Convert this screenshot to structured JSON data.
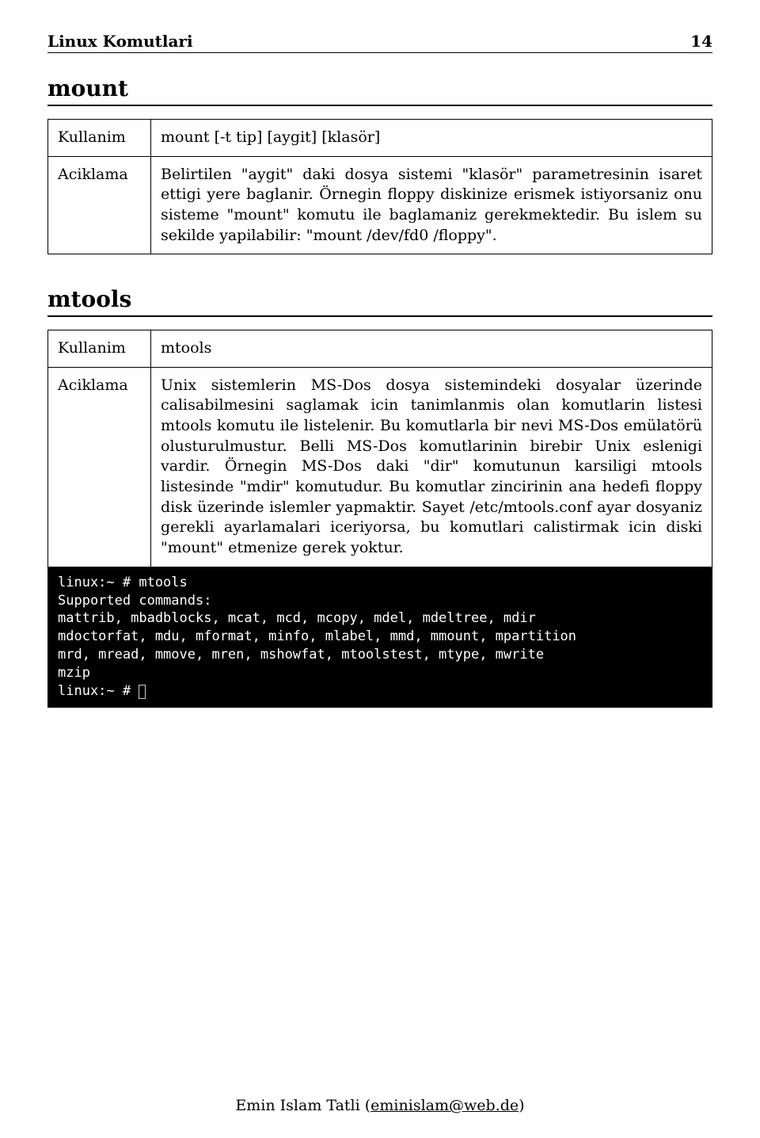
{
  "header": {
    "title": "Linux Komutlari",
    "page": "14"
  },
  "sections": {
    "mount": {
      "title": "mount",
      "kullanim_label": "Kullanim",
      "kullanim_value": "mount [-t tip] [aygit] [klasör]",
      "aciklama_label": "Aciklama",
      "aciklama_value": "Belirtilen \"aygit\" daki dosya sistemi \"klasör\" parametresinin isaret ettigi yere baglanir. Örnegin floppy diskinize erismek istiyorsaniz onu sisteme \"mount\" komutu ile baglamaniz gerekmektedir. Bu islem su sekilde yapilabilir: \"mount /dev/fd0 /floppy\"."
    },
    "mtools": {
      "title": "mtools",
      "kullanim_label": "Kullanim",
      "kullanim_value": "mtools",
      "aciklama_label": "Aciklama",
      "aciklama_value": "Unix sistemlerin MS-Dos dosya sistemindeki dosyalar üzerinde calisabilmesini saglamak icin tanimlanmis olan komutlarin listesi mtools komutu ile listelenir. Bu komutlarla bir nevi MS-Dos emülatörü olusturulmustur. Belli MS-Dos komutlarinin birebir Unix eslenigi vardir. Örnegin MS-Dos daki \"dir\" komutunun karsiligi mtools listesinde \"mdir\" komutudur. Bu komutlar zincirinin ana hedefi floppy disk üzerinde islemler yapmaktir. Sayet /etc/mtools.conf ayar dosyaniz gerekli ayarlamalari iceriyorsa, bu komutlari calistirmak icin diski \"mount\" etmenize gerek yoktur.",
      "terminal_lines": [
        "linux:~ # mtools",
        "Supported commands:",
        "mattrib, mbadblocks, mcat, mcd, mcopy, mdel, mdeltree, mdir",
        "mdoctorfat, mdu, mformat, minfo, mlabel, mmd, mmount, mpartition",
        "mrd, mread, mmove, mren, mshowfat, mtoolstest, mtype, mwrite",
        "mzip",
        "linux:~ # "
      ]
    }
  },
  "footer": {
    "author": "Emin Islam Tatli",
    "email": "eminislam@web.de"
  }
}
